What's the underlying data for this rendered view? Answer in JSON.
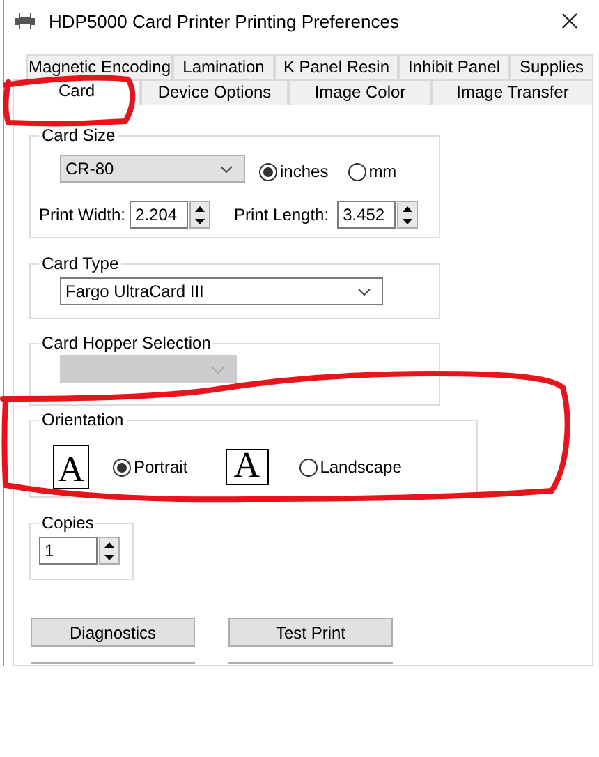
{
  "window": {
    "title": "HDP5000 Card Printer Printing Preferences"
  },
  "tab_rows": [
    [
      {
        "label": "Magnetic Encoding",
        "selected": false
      },
      {
        "label": "Lamination",
        "selected": false
      },
      {
        "label": "K Panel Resin",
        "selected": false
      },
      {
        "label": "Inhibit Panel",
        "selected": false
      },
      {
        "label": "Supplies",
        "selected": false
      }
    ],
    [
      {
        "label": "Card",
        "selected": true
      },
      {
        "label": "Device Options",
        "selected": false
      },
      {
        "label": "Image Color",
        "selected": false
      },
      {
        "label": "Image Transfer",
        "selected": false
      }
    ]
  ],
  "card_size": {
    "label": "Card Size",
    "dropdown": "CR-80",
    "units": [
      {
        "label": "inches",
        "selected": true
      },
      {
        "label": "mm",
        "selected": false
      }
    ],
    "print_width": {
      "label": "Print Width:",
      "value": "2.204"
    },
    "print_length": {
      "label": "Print Length:",
      "value": "3.452"
    }
  },
  "card_type": {
    "label": "Card Type",
    "dropdown": "Fargo UltraCard III"
  },
  "card_hopper_selection": {
    "label": "Card Hopper Selection",
    "disabled": true
  },
  "orientation": {
    "label": "Orientation",
    "options": [
      {
        "label": "Portrait",
        "icon_glyph": "A",
        "kind": "portrait",
        "selected": true
      },
      {
        "label": "Landscape",
        "icon_glyph": "A",
        "kind": "landscape",
        "selected": false
      }
    ]
  },
  "copies": {
    "label": "Copies",
    "value": "1"
  },
  "buttons": [
    "Diagnostics",
    "Test Print"
  ]
}
